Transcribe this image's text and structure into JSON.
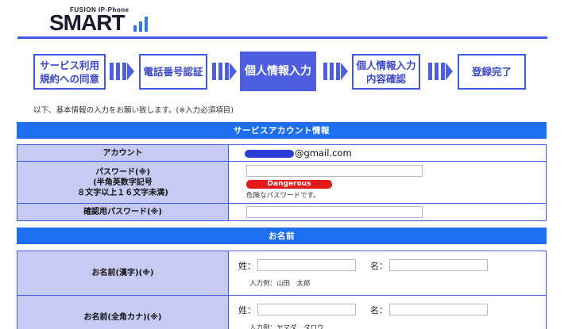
{
  "logo": {
    "subtitle": "FUSION IP-Phone",
    "title": "SMART"
  },
  "steps": [
    {
      "label_line1": "サービス利用",
      "label_line2": "規約への同意",
      "active": false
    },
    {
      "label_line1": "電話番号認証",
      "label_line2": "",
      "active": false
    },
    {
      "label_line1": "個人情報入力",
      "label_line2": "",
      "active": true
    },
    {
      "label_line1": "個人情報入力",
      "label_line2": "内容確認",
      "active": false
    },
    {
      "label_line1": "登録完了",
      "label_line2": "",
      "active": false
    }
  ],
  "intro": "以下、基本情報の入力をお願い致します。(※入力必須項目)",
  "account_section": {
    "title": "サービスアカウント情報",
    "account_label": "アカウント",
    "account_value_suffix": "@gmail.com",
    "password_label_line1": "パスワード(※)",
    "password_label_line2": "(半角英数字記号",
    "password_label_line3": "８文字以上１６文字未満)",
    "password_value": "",
    "strength_badge": "Dangerous",
    "strength_message": "危険なパスワードです。",
    "confirm_label": "確認用パスワード(※)",
    "confirm_value": ""
  },
  "name_section": {
    "title": "お名前",
    "kanji_label": "お名前(漢字)(※)",
    "kana_label": "お名前(全角カナ)(※)",
    "sei_label": "姓：",
    "mei_label": "名：",
    "kanji_sei_value": "",
    "kanji_mei_value": "",
    "kana_sei_value": "",
    "kana_mei_value": "",
    "kanji_example": "入力例：山田　太郎",
    "kana_example": "入力例：ヤマダ　タロウ"
  },
  "colors": {
    "accent": "#3f5ae0",
    "section_header": "#1e6ff0",
    "label_bg": "#c7caf3",
    "danger": "#e21a1a"
  }
}
